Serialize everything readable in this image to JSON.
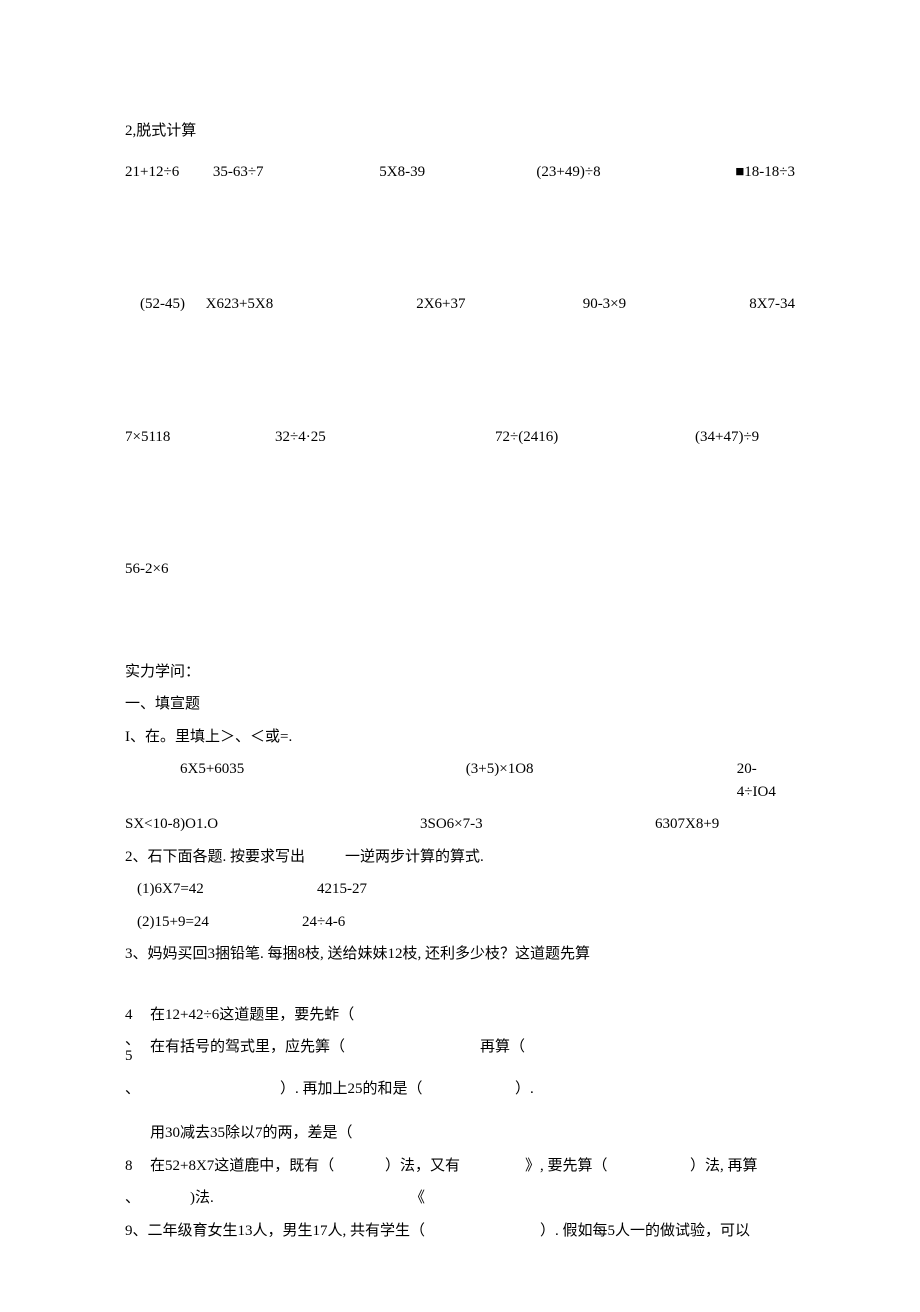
{
  "section2": {
    "title": "2,脱式计算",
    "row1": [
      "21+12÷6",
      "35-63÷7",
      "5X8-39",
      "(23+49)÷8",
      "■18-18÷3"
    ],
    "row2": [
      "(52-45)",
      "X623+5X8",
      "2X6+37",
      "90-3×9",
      "8X7-34"
    ],
    "row3": [
      "7×5118",
      "32÷4·25",
      "72÷(2416)",
      "(34+47)÷9"
    ],
    "row4": [
      "56-2×6"
    ]
  },
  "ability": {
    "title": "实力学问：",
    "fill_title": "一、填宣题",
    "q1": {
      "prompt": "I、在。里填上＞、＜或=.",
      "r1": [
        "6X5+6035",
        "(3+5)×1O8",
        "20-4÷IO4"
      ],
      "r2": [
        "SX<10-8)O1.O",
        "3SO6×7-3",
        "6307X8+9"
      ]
    },
    "q2": {
      "prompt_a": "2、石下面各题. 按要求写出",
      "prompt_b": "一逆两步计算的算式.",
      "l1a": "(1)6X7=42",
      "l1b": "4215-27",
      "l2a": "(2)15+9=24",
      "l2b": "24÷4-6"
    },
    "q3": "3、妈妈买回3捆铅笔. 每捆8枝, 送给妹妹12枝, 还利多少枝？这道题先算",
    "q4": {
      "num": "4",
      "punct": "、",
      "text": "在12+42÷6这道题里，要先蚱（"
    },
    "q5": {
      "num": "5",
      "punct": "、",
      "a": "在有括号的驾式里，应先筭（",
      "b": "再算（",
      "c": "）. 再加上25的和是（",
      "d": "）."
    },
    "q6": "用30减去35除以7的两，差是（",
    "q8": {
      "num": "8",
      "punct": "、",
      "a": "在52+8X7这道鹿中，既有（",
      "b": "）法，又有",
      "c": "》, 要先算（",
      "d": "）法, 再算",
      "e": "《",
      "f": ")法."
    },
    "q9": {
      "a": "9、二年级育女生13人，男生17人, 共有学生（",
      "b": "）. 假如每5人一的做试验，可以"
    }
  }
}
